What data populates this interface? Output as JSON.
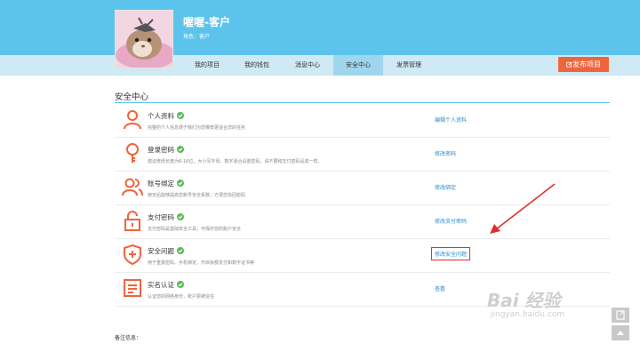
{
  "profile": {
    "name": "喔喔-客户",
    "role": "角色：客户"
  },
  "nav": {
    "tabs": [
      {
        "label": "我的项目"
      },
      {
        "label": "我的钱包"
      },
      {
        "label": "消息中心"
      },
      {
        "label": "安全中心"
      },
      {
        "label": "发票管理"
      }
    ],
    "active_tab": "安全中心",
    "publish_label": "发布项目"
  },
  "section": {
    "title": "安全中心"
  },
  "rows": [
    {
      "icon": "person-icon",
      "title": "个人资料",
      "desc": "完整的个人信息便于我们为您推荐更适合您的任务",
      "link": "编辑个人资料"
    },
    {
      "icon": "key-icon",
      "title": "登录密码",
      "desc": "建议修改长度为6-16位，大小写字母、数字混合设置密码，请不要和支付密码设成一样。",
      "link": "修改密码"
    },
    {
      "icon": "users-icon",
      "title": "账号绑定",
      "desc": "绑定后能够提高您账号安全系数，方便您找回密码",
      "link": "修改绑定"
    },
    {
      "icon": "lock-icon",
      "title": "支付密码",
      "desc": "支付密码是基础安全工具，可保护您的账户安全",
      "link": "修改支付密码"
    },
    {
      "icon": "shield-icon",
      "title": "安全问题",
      "desc": "用于重置密码、手机绑定、开启余额支付和数字证书等",
      "link": "修改安全问题"
    },
    {
      "icon": "id-card-icon",
      "title": "实名认证",
      "desc": "认证您的网络身份，账户更被信任",
      "link": "查看"
    }
  ],
  "remarks": "备注信息：",
  "watermark": {
    "line1": "Bai 经验",
    "line2": "jingyan.baidu.com"
  },
  "colors": {
    "accent": "#5cc4ec",
    "icon": "#f0643c",
    "link": "#2a8ed0",
    "check": "#5cb85c",
    "highlight": "#e0302a"
  }
}
